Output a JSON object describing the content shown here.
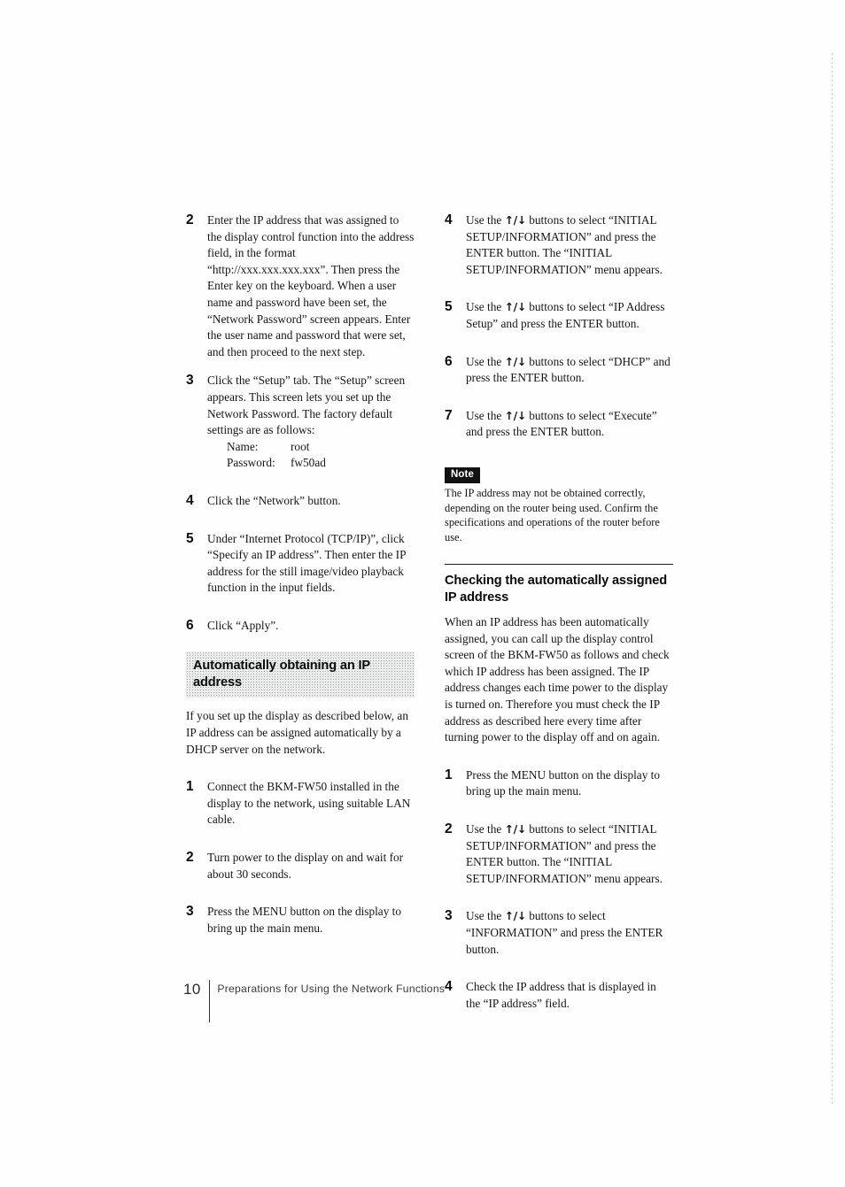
{
  "document": {
    "page_number": "10",
    "footer_text": "Preparations for Using the Network Functions"
  },
  "left_column": {
    "steps_continued": [
      {
        "number": "2",
        "text": "Enter the IP address that was assigned to the display control function into the address field, in the format “http://xxx.xxx.xxx.xxx”. Then press the Enter key on the keyboard. When a user name and password have been set, the “Network Password” screen appears. Enter the user name and password that were set, and then proceed to the next step."
      },
      {
        "number": "3",
        "text": "Click the “Setup” tab. The “Setup” screen appears. This screen lets you set up the Network Password. The factory default settings are as follows:",
        "definitions": [
          {
            "term": "Name:",
            "value": "root"
          },
          {
            "term": "Password:",
            "value": "fw50ad"
          }
        ]
      },
      {
        "number": "4",
        "text": "Click the “Network” button."
      },
      {
        "number": "5",
        "text": "Under “Internet Protocol (TCP/IP)”, click “Specify an IP address”. Then enter the IP address for the still image/video playback function in the input fields."
      },
      {
        "number": "6",
        "text": "Click “Apply”."
      }
    ],
    "section_heading": "Automatically obtaining an IP address",
    "section_intro": "If you set up the display as described below, an IP address can be assigned automatically by a DHCP server on the network.",
    "section_steps": [
      {
        "number": "1",
        "text": "Connect the BKM-FW50 installed in the display to the network, using suitable LAN cable."
      },
      {
        "number": "2",
        "text": "Turn power to the display on and wait for about 30 seconds."
      },
      {
        "number": "3",
        "text": "Press the MENU button on the display to bring up the main menu."
      }
    ]
  },
  "right_column": {
    "steps_continued": [
      {
        "number": "4",
        "text_before": "Use the ",
        "arrows": "↑/↓",
        "text_after": " buttons to select “INITIAL SETUP/INFORMATION” and press the ENTER button. The “INITIAL SETUP/INFORMATION” menu appears."
      },
      {
        "number": "5",
        "text_before": "Use the ",
        "arrows": "↑/↓",
        "text_after": " buttons to select “IP Address Setup” and press the ENTER button."
      },
      {
        "number": "6",
        "text_before": "Use the ",
        "arrows": "↑/↓",
        "text_after": " buttons to select “DHCP” and press the ENTER button."
      },
      {
        "number": "7",
        "text_before": "Use the ",
        "arrows": "↑/↓",
        "text_after": " buttons to select “Execute” and press the ENTER button."
      }
    ],
    "note": {
      "label": "Note",
      "body": "The IP address may not be obtained correctly, depending on the router being used. Confirm the specifications and operations of the router before use."
    },
    "section_heading": "Checking the automatically assigned IP address",
    "section_intro": "When an IP address has been automatically assigned, you can call up the display control screen of the BKM-FW50 as follows and check which IP address has been assigned. The IP address changes each time power to the display is turned on. Therefore you must check the IP address as described here every time after turning power to the display off and on again.",
    "section_steps": [
      {
        "number": "1",
        "text_before": "Press the MENU button on the display to bring up the main menu.",
        "arrows": "",
        "text_after": ""
      },
      {
        "number": "2",
        "text_before": "Use the ",
        "arrows": "↑/↓",
        "text_after": " buttons to select “INITIAL SETUP/INFORMATION” and press the ENTER button. The “INITIAL SETUP/INFORMATION” menu appears."
      },
      {
        "number": "3",
        "text_before": "Use the ",
        "arrows": "↑/↓",
        "text_after": " buttons to select “INFORMATION” and press the ENTER button."
      },
      {
        "number": "4",
        "text_before": "Check the IP address that is displayed in the “IP address” field.",
        "arrows": "",
        "text_after": ""
      }
    ]
  }
}
